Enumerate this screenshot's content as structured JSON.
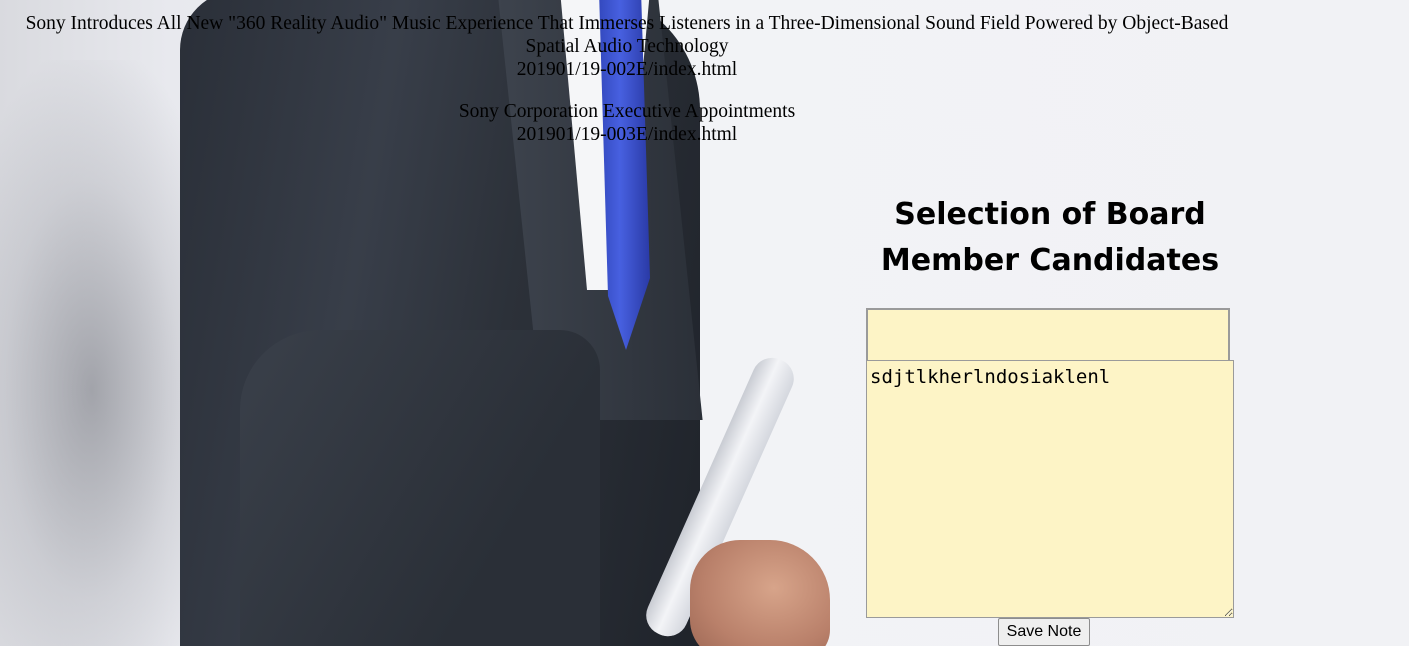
{
  "news": [
    {
      "title": "Sony Introduces All New \"360 Reality Audio\" Music Experience That Immerses Listeners in a Three-Dimensional Sound Field Powered by Object-Based Spatial Audio Technology",
      "path": "201901/19-002E/index.html"
    },
    {
      "title": "Sony Corporation Executive Appointments",
      "path": "201901/19-003E/index.html"
    }
  ],
  "panel": {
    "heading": "Selection of Board Member Candidates",
    "note_title_value": "",
    "note_body_value": "sdjtlkherlndosiaklenl",
    "save_label": "Save Note"
  }
}
